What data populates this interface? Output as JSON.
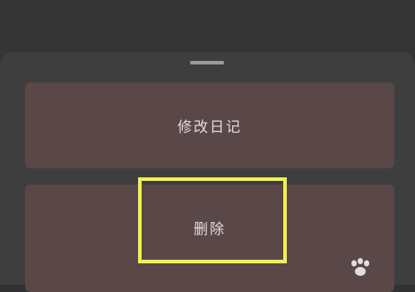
{
  "sheet": {
    "actions": [
      {
        "label": "修改日记"
      },
      {
        "label": "删除"
      }
    ]
  },
  "colors": {
    "backdrop": "#353535",
    "sheet": "#3e3e3e",
    "button": "#5a4748",
    "button_text": "#e2dcdc",
    "highlight": "#f0f050"
  },
  "icons": {
    "corner_watermark": "paw-icon"
  }
}
